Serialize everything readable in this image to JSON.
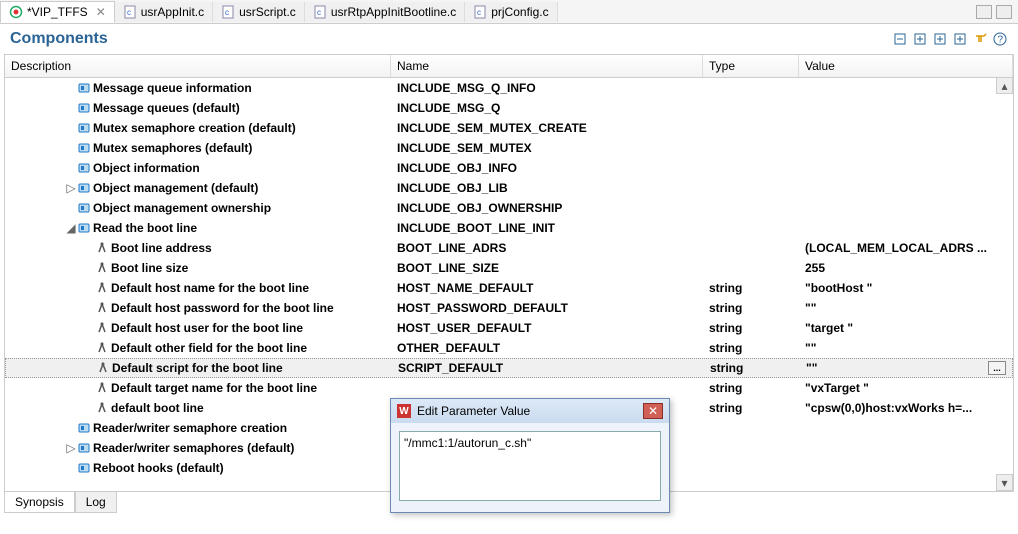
{
  "tabs": [
    {
      "label": "*VIP_TFFS",
      "icon": "target"
    },
    {
      "label": "usrAppInit.c",
      "icon": "cfile"
    },
    {
      "label": "usrScript.c",
      "icon": "cfile"
    },
    {
      "label": "usrRtpAppInitBootline.c",
      "icon": "cfile"
    },
    {
      "label": "prjConfig.c",
      "icon": "cfile"
    }
  ],
  "section_title": "Components",
  "columns": {
    "desc": "Description",
    "name": "Name",
    "type": "Type",
    "val": "Value"
  },
  "rows": [
    {
      "indent": 3,
      "twisty": "",
      "icon": "comp",
      "desc": "Message queue information",
      "name": "INCLUDE_MSG_Q_INFO",
      "type": "",
      "val": ""
    },
    {
      "indent": 3,
      "twisty": "",
      "icon": "comp",
      "desc": "Message queues (default)",
      "name": "INCLUDE_MSG_Q",
      "type": "",
      "val": ""
    },
    {
      "indent": 3,
      "twisty": "",
      "icon": "comp",
      "desc": "Mutex semaphore creation (default)",
      "name": "INCLUDE_SEM_MUTEX_CREATE",
      "type": "",
      "val": ""
    },
    {
      "indent": 3,
      "twisty": "",
      "icon": "comp",
      "desc": "Mutex semaphores (default)",
      "name": "INCLUDE_SEM_MUTEX",
      "type": "",
      "val": ""
    },
    {
      "indent": 3,
      "twisty": "",
      "icon": "comp",
      "desc": "Object information",
      "name": "INCLUDE_OBJ_INFO",
      "type": "",
      "val": ""
    },
    {
      "indent": 3,
      "twisty": "▷",
      "icon": "comp",
      "desc": "Object management (default)",
      "name": "INCLUDE_OBJ_LIB",
      "type": "",
      "val": ""
    },
    {
      "indent": 3,
      "twisty": "",
      "icon": "comp",
      "desc": "Object management ownership",
      "name": "INCLUDE_OBJ_OWNERSHIP",
      "type": "",
      "val": ""
    },
    {
      "indent": 3,
      "twisty": "◢",
      "icon": "comp",
      "desc": "Read the boot line",
      "name": "INCLUDE_BOOT_LINE_INIT",
      "type": "",
      "val": ""
    },
    {
      "indent": 4,
      "twisty": "",
      "icon": "param",
      "desc": "Boot line address",
      "name": "BOOT_LINE_ADRS",
      "type": "",
      "val": "(LOCAL_MEM_LOCAL_ADRS ..."
    },
    {
      "indent": 4,
      "twisty": "",
      "icon": "param",
      "desc": "Boot line size",
      "name": "BOOT_LINE_SIZE",
      "type": "",
      "val": "255"
    },
    {
      "indent": 4,
      "twisty": "",
      "icon": "param",
      "desc": "Default host name for the boot line",
      "name": "HOST_NAME_DEFAULT",
      "type": "string",
      "val": "\"bootHost \""
    },
    {
      "indent": 4,
      "twisty": "",
      "icon": "param",
      "desc": "Default host password for the boot line",
      "name": "HOST_PASSWORD_DEFAULT",
      "type": "string",
      "val": "\"\""
    },
    {
      "indent": 4,
      "twisty": "",
      "icon": "param",
      "desc": "Default host user for the boot line",
      "name": "HOST_USER_DEFAULT",
      "type": "string",
      "val": "\"target \""
    },
    {
      "indent": 4,
      "twisty": "",
      "icon": "param",
      "desc": "Default other field for the boot line",
      "name": "OTHER_DEFAULT",
      "type": "string",
      "val": "\"\""
    },
    {
      "indent": 4,
      "twisty": "",
      "icon": "param",
      "desc": "Default script for the boot line",
      "name": "SCRIPT_DEFAULT",
      "type": "string",
      "val": "\"\"",
      "selected": true,
      "editable": true
    },
    {
      "indent": 4,
      "twisty": "",
      "icon": "param",
      "desc": "Default target name for the boot line",
      "name": "",
      "type": "string",
      "val": "\"vxTarget \""
    },
    {
      "indent": 4,
      "twisty": "",
      "icon": "param",
      "desc": "default boot line",
      "name": "",
      "type": "string",
      "val": "\"cpsw(0,0)host:vxWorks h=..."
    },
    {
      "indent": 3,
      "twisty": "",
      "icon": "comp",
      "desc": "Reader/writer semaphore creation",
      "name": "",
      "type": "",
      "val": ""
    },
    {
      "indent": 3,
      "twisty": "▷",
      "icon": "comp",
      "desc": "Reader/writer semaphores (default)",
      "name": "",
      "type": "",
      "val": ""
    },
    {
      "indent": 3,
      "twisty": "",
      "icon": "comp",
      "desc": "Reboot hooks (default)",
      "name": "",
      "type": "",
      "val": ""
    }
  ],
  "bottom_tabs": [
    "Synopsis",
    "Log"
  ],
  "dialog": {
    "title": "Edit Parameter Value",
    "value": "\"/mmc1:1/autorun_c.sh\""
  }
}
